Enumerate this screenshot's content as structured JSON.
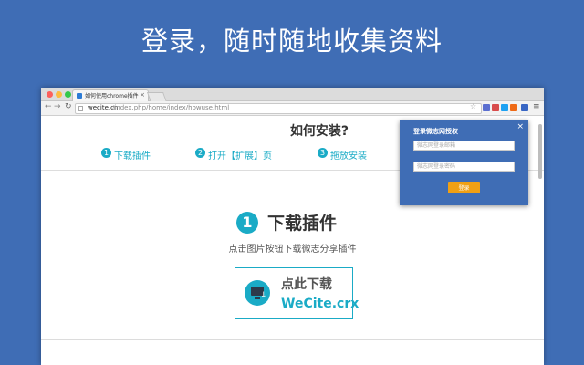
{
  "headline": "登录，随时随地收集资料",
  "browser": {
    "tab_title": "如何使用chrome插件",
    "tab_close": "×",
    "url_host": "wecite.cn",
    "url_path": "/index.php/home/index/howuse.html",
    "menu_icon": "≡"
  },
  "page": {
    "title": "如何安装?",
    "steps": [
      {
        "num": "1",
        "label": "下载插件"
      },
      {
        "num": "2",
        "label": "打开【扩展】页"
      },
      {
        "num": "3",
        "label": "拖放安装"
      }
    ],
    "section": {
      "num": "1",
      "title": "下载插件",
      "subtitle": "点击图片按钮下载微志分享插件"
    },
    "download": {
      "label": "点此下载",
      "filename": "WeCite.crx"
    }
  },
  "popup": {
    "title": "登录微志网授权",
    "close": "×",
    "email_placeholder": "微志网登录邮箱",
    "password_placeholder": "微志网登录密码",
    "login_label": "登录"
  },
  "icons": {
    "back": "back-arrow-icon",
    "forward": "forward-arrow-icon",
    "reload": "reload-icon",
    "star": "bookmark-star-icon",
    "download": "download-monitor-icon"
  },
  "colors": {
    "background": "#3f6db5",
    "accent": "#1aabc6",
    "login_button": "#f0a014"
  }
}
